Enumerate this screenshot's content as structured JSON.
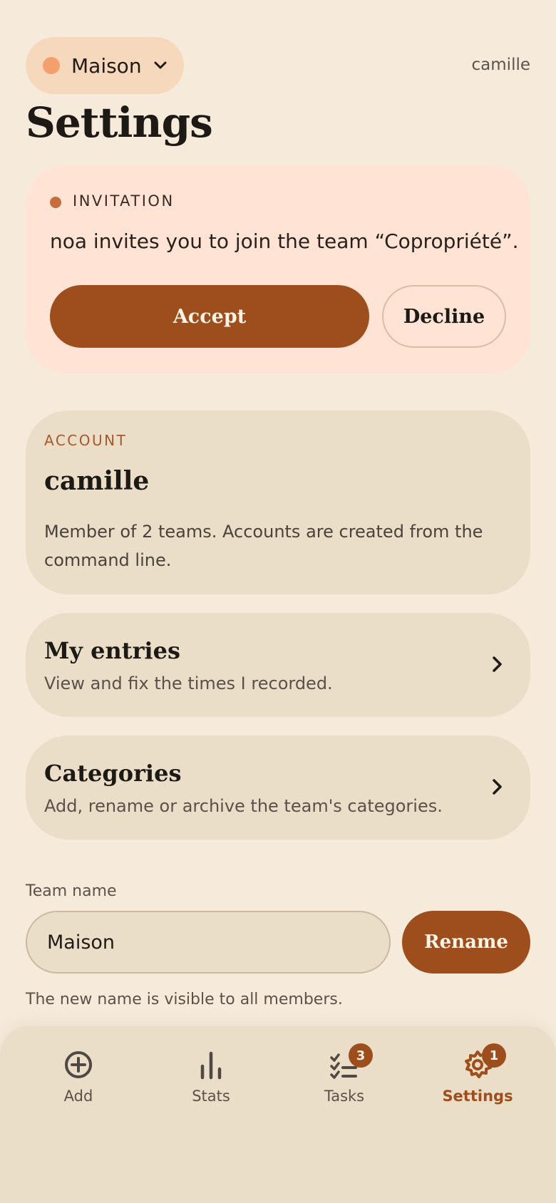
{
  "header": {
    "team_name": "Maison",
    "user": "camille",
    "title": "Settings"
  },
  "invitation": {
    "label": "INVITATION",
    "message": "noa invites you to join the team “Copropriété”.",
    "accept_label": "Accept",
    "decline_label": "Decline"
  },
  "account": {
    "kicker": "ACCOUNT",
    "name": "camille",
    "description": "Member of 2 teams. Accounts are created from the command line."
  },
  "links": {
    "entries": {
      "title": "My entries",
      "subtitle": "View and fix the times I recorded."
    },
    "categories": {
      "title": "Categories",
      "subtitle": "Add, rename or archive the team's categories."
    }
  },
  "team_form": {
    "label": "Team name",
    "value": "Maison",
    "button": "Rename",
    "help": "The new name is visible to all members."
  },
  "bottom_nav": {
    "items": [
      {
        "label": "Add",
        "icon": "plus-circle-icon"
      },
      {
        "label": "Stats",
        "icon": "bar-chart-icon"
      },
      {
        "label": "Tasks",
        "icon": "checklist-icon",
        "badge": "3"
      },
      {
        "label": "Settings",
        "icon": "gear-icon",
        "badge": "1",
        "active": true
      }
    ]
  },
  "colors": {
    "background": "#f6ebdb",
    "accent": "#9d4e1c",
    "card": "#ebdec8",
    "invitation_bg": "#ffe3d5",
    "team_dot": "#f4a06c"
  }
}
